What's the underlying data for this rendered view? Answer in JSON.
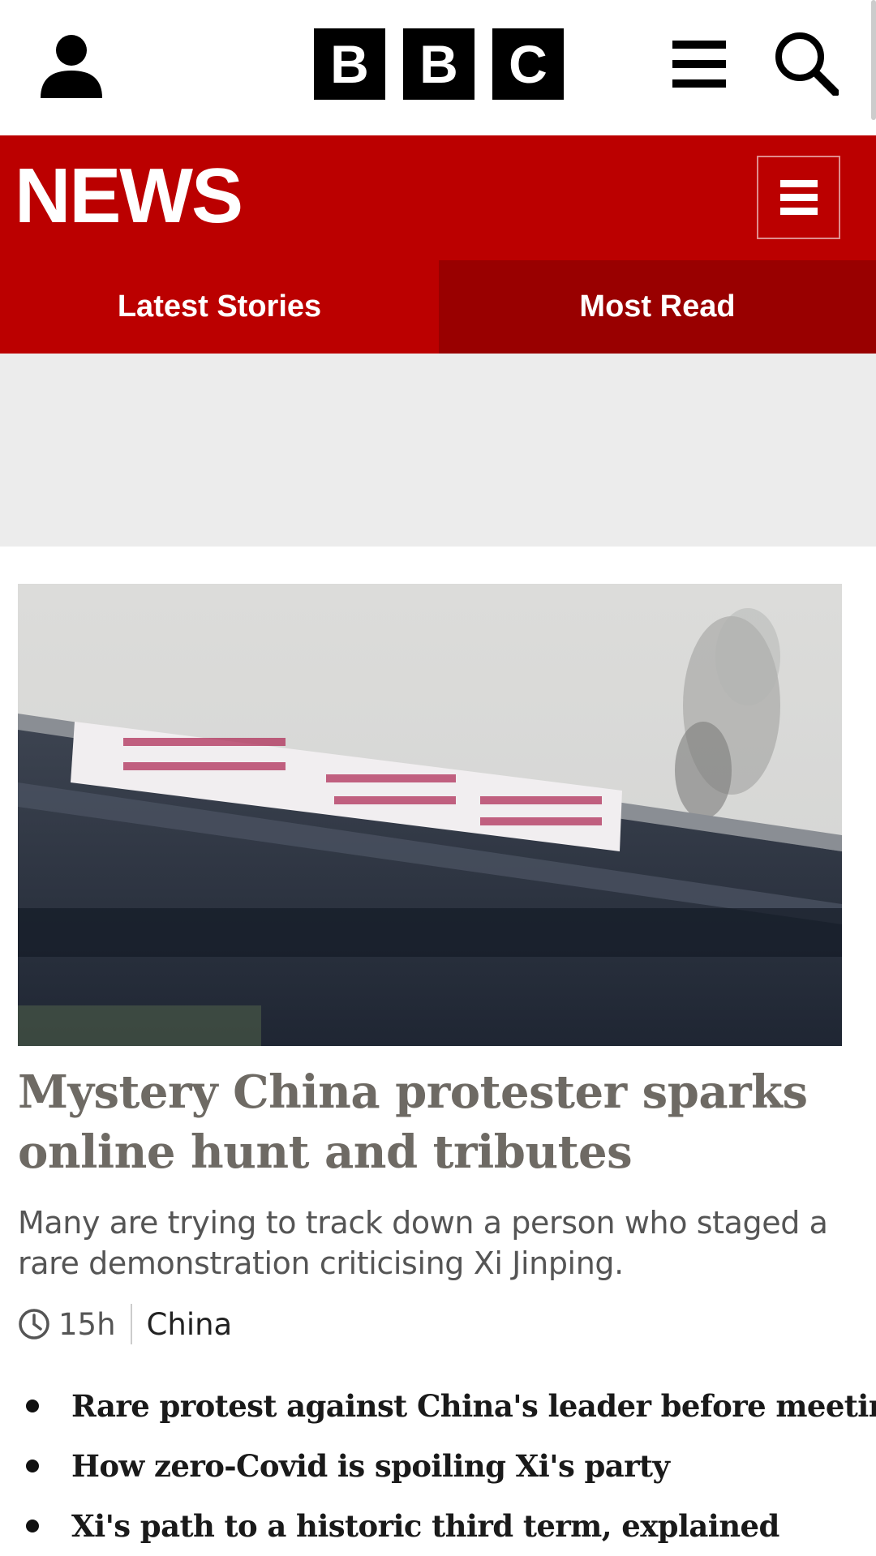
{
  "header": {
    "logo_letters": [
      "B",
      "B",
      "C"
    ]
  },
  "news_bar": {
    "title": "NEWS"
  },
  "tabs": [
    {
      "label": "Latest Stories"
    },
    {
      "label": "Most Read"
    }
  ],
  "article": {
    "headline": "Mystery China protester sparks online hunt and tributes",
    "summary": "Many are trying to track down a person who staged a rare demonstration criticising Xi Jinping.",
    "time": "15h",
    "topic": "China"
  },
  "related_links": [
    "Rare protest against China's leader before meeting",
    "How zero-Covid is spoiling Xi's party",
    "Xi's path to a historic third term, explained"
  ],
  "colors": {
    "brand_red": "#bb0000",
    "tab_dark_red": "#990000",
    "headline_grey": "#6e6a64"
  },
  "icons": [
    "account-icon",
    "menu-icon",
    "search-icon",
    "clock-icon"
  ]
}
